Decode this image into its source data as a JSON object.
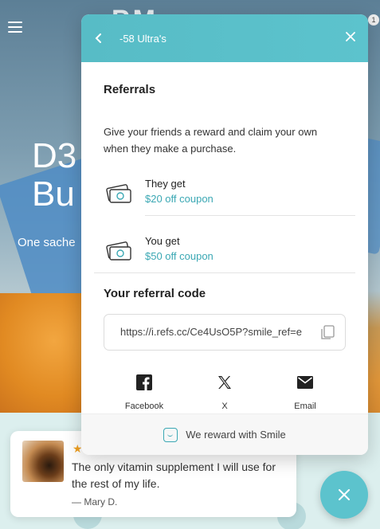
{
  "store": {
    "hero_title": "D3\nBu",
    "hero_subtitle": "One sache",
    "cart_count": "1"
  },
  "review": {
    "stars": "★",
    "text": "The only vitamin supplement I will use for the rest of my life.",
    "author": "— Mary D."
  },
  "widget": {
    "header_title": "-58 Ultra's",
    "referrals_title": "Referrals",
    "referrals_desc": "Give your friends a reward and claim your own when they make a purchase.",
    "rewards": [
      {
        "who": "They get",
        "amount": "$20 off coupon"
      },
      {
        "who": "You get",
        "amount": "$50 off coupon"
      }
    ],
    "code_title": "Your referral code",
    "code_value": "https://i.refs.cc/Ce4UsO5P?smile_ref=e",
    "share": [
      {
        "label": "Facebook",
        "icon": "facebook-icon"
      },
      {
        "label": "X",
        "icon": "x-icon"
      },
      {
        "label": "Email",
        "icon": "email-icon"
      }
    ],
    "footer_text": "We reward with Smile",
    "accent": "#5cc3cd"
  }
}
